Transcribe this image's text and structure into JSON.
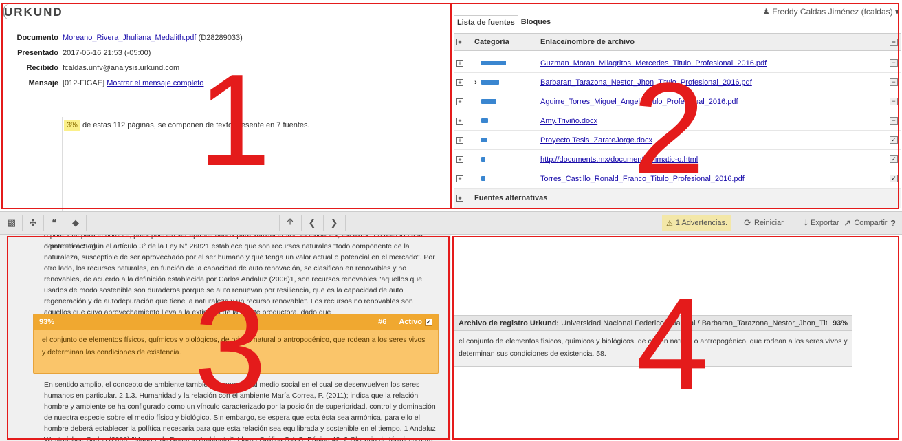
{
  "app": {
    "logo": "URKUND"
  },
  "meta": {
    "document_label": "Documento",
    "document_link": "Moreano_Rivera_Jhuliana_Medalith.pdf",
    "document_id": "(D28289033)",
    "submitted_label": "Presentado",
    "submitted_value": "2017-05-16 21:53 (-05:00)",
    "received_label": "Recibido",
    "received_value": "fcaldas.unfv@analysis.urkund.com",
    "message_label": "Mensaje",
    "message_value": "[012-FIGAE]",
    "message_link": "Mostrar el mensaje completo",
    "percent": "3%",
    "summary": "de estas 112 páginas, se componen de texto presente en 7 fuentes."
  },
  "sources": {
    "tabs": [
      "Lista de fuentes",
      "Bloques"
    ],
    "user": "Freddy Caldas Jiménez (fcaldas)",
    "header_category": "Categoría",
    "header_link": "Enlace/nombre de archivo",
    "rows": [
      {
        "name": "Guzman_Moran_Milagritos_Mercedes_Titulo_Profesional_2016.pdf",
        "bar": 0.9,
        "checked": false,
        "selected": false
      },
      {
        "name": "Barbaran_Tarazona_Nestor_Jhon_Titulo_Profesional_2016.pdf",
        "bar": 0.65,
        "checked": false,
        "selected": true
      },
      {
        "name": "Aguirre_Torres_Miguel_Angel_Titulo_Profesional_2016.pdf",
        "bar": 0.55,
        "checked": false,
        "selected": false
      },
      {
        "name": "Amy.Triviño.docx",
        "bar": 0.25,
        "checked": false,
        "selected": false
      },
      {
        "name": "Proyecto Tesis_ZarateJorge.docx",
        "bar": 0.2,
        "checked": true,
        "selected": false
      },
      {
        "name": "http://documents.mx/documents/climatic-o.html",
        "bar": 0.1,
        "checked": true,
        "selected": false
      },
      {
        "name": "Torres_Castillo_Ronald_Franco_Titulo_Profesional_2016.pdf",
        "bar": 0.1,
        "checked": true,
        "selected": false
      }
    ],
    "alt_sources": "Fuentes alternativas"
  },
  "toolbar": {
    "warnings": "1 Advertencias.",
    "restart": "Reiniciar",
    "export": "Exportar",
    "share": "Compartir"
  },
  "document_text": {
    "top_cut": "o potencial para el hombre, pues pueden ser aprovechados para satisfacer las necesidades, escasos con relación a la demanda actual",
    "para1": "o potencial. Según el artículo 3° de la Ley N° 26821 establece que son recursos naturales \"todo componente de la naturaleza, susceptible de ser aprovechado por el ser humano y que tenga un valor actual o potencial en el mercado\". Por otro lado, los recursos naturales, en función de la capacidad de auto renovación, se clasifican en renovables y no renovables, de acuerdo a la definición establecida por Carlos Andaluz (2006)1, son recursos renovables \"aquellos que usados de modo sostenible son duraderos porque se auto renuevan por resiliencia, que es la capacidad de auto regeneración y de autodepuración que tiene la naturaleza y un recurso renovable\". Los recursos no renovables son aquellos que cuyo aprovechamiento lleva a la extinción de la fuente productora, dado que",
    "match_percent": "93%",
    "match_number": "#6",
    "match_active": "Activo",
    "match_text": "el conjunto de elementos físicos, químicos y biológicos, de origen natural o antropogénico, que rodean a los seres vivos y determinan las condiciones de existencia.",
    "para2": "En sentido amplio, el concepto de ambiente también comprende al medio social en el cual se desenvuelven los seres humanos en particular. 2.1.3. Humanidad y la relación con el ambiente María Correa, P. (2011); indica que la relación hombre y ambiente se ha configurado como un vínculo caracterizado por la posición de superioridad, control y dominación de nuestra especie sobre el medio físico y biológico. Sin embargo, se espera que esta ésta sea armónica, para ello el hombre deberá establecer la política necesaria para que esta relación sea equilibrada y sostenible en el tiempo. 1 Andaluz Westreicher, Carlos (2006) \"Manual de Derecho Ambiental\". Llama Gráfica S.A.C. Página 42. 2 Glosario de términos para la Gestión Ambiental Peruana."
  },
  "source_view": {
    "label": "Archivo de registro Urkund:",
    "value": "Universidad Nacional Federico Villarreal / Barbaran_Tarazona_Nestor_Jhon_Titulo_Profesional...",
    "percent": "93%",
    "text": "el conjunto de elementos físicos, químicos y biológicos, de origen natural o antropogénico, que rodean a los seres vivos y determinan sus condiciones de existencia. 58."
  },
  "annotations": [
    "1",
    "2",
    "3",
    "4"
  ]
}
